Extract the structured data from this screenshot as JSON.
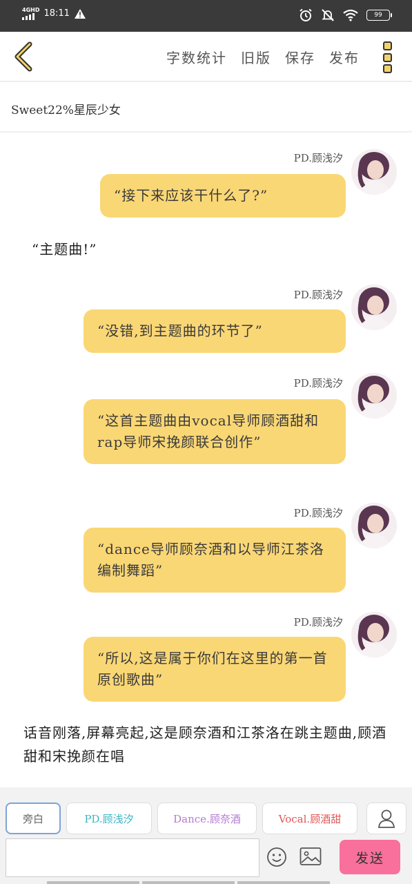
{
  "status": {
    "network": "4GHD",
    "time": "18:11",
    "battery": "99"
  },
  "header": {
    "actions": [
      "字数统计",
      "旧版",
      "保存",
      "发布"
    ]
  },
  "title": "Sweet22%星辰少女",
  "messages": [
    {
      "speaker": "PD.顾浅汐",
      "text": "“接下来应该干什么了?”"
    },
    {
      "speaker": "PD.顾浅汐",
      "text": "“没错,到主题曲的环节了”"
    },
    {
      "speaker": "PD.顾浅汐",
      "text": "“这首主题曲由vocal导师顾酒甜和rap导师宋挽颜联合创作”"
    },
    {
      "speaker": "PD.顾浅汐",
      "text": "“dance导师顾奈酒和以导师江茶洛编制舞蹈”"
    },
    {
      "speaker": "PD.顾浅汐",
      "text": "“所以,这是属于你们在这里的第一首原创歌曲”"
    }
  ],
  "narrations": [
    "“主题曲!”",
    "话音刚落,屏幕亮起,这是顾奈酒和江茶洛在跳主题曲,顾酒甜和宋挽颜在唱"
  ],
  "roles": [
    {
      "label": "旁白",
      "color": "#666666"
    },
    {
      "label": "PD.顾浅汐",
      "color": "#3bb6c4"
    },
    {
      "label": "Dance.顾奈酒",
      "color": "#b57ad4"
    },
    {
      "label": "Vocal.顾酒甜",
      "color": "#e05656"
    }
  ],
  "composer": {
    "input_value": "",
    "send_label": "发送"
  },
  "colors": {
    "bubble": "#fad775",
    "send": "#f8709b",
    "more_dots": "#f3d269"
  }
}
